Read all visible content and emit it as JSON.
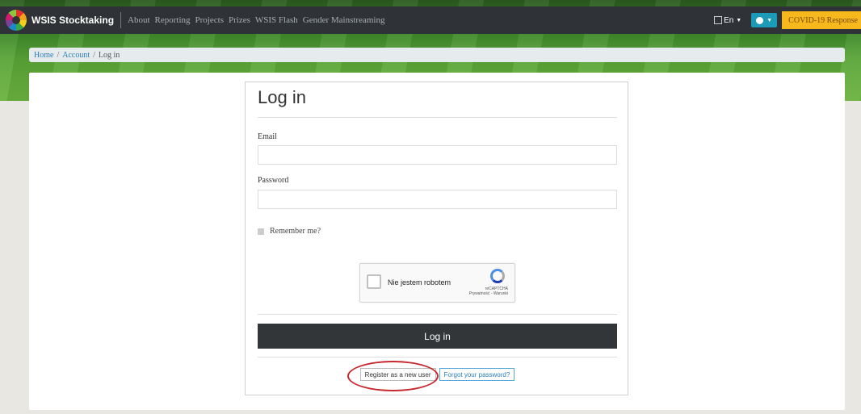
{
  "navbar": {
    "brand": "WSIS Stocktaking",
    "links": [
      "About",
      "Reporting",
      "Projects",
      "Prizes",
      "WSIS Flash",
      "Gender Mainstreaming"
    ],
    "language": "En",
    "covid_button": "COVID-19 Response"
  },
  "breadcrumb": {
    "home": "Home",
    "account": "Account",
    "current": "Log in",
    "separator": "/"
  },
  "login": {
    "title": "Log in",
    "email_label": "Email",
    "email_value": "",
    "password_label": "Password",
    "password_value": "",
    "remember_label": "Remember me?",
    "captcha_text": "Nie jestem robotem",
    "captcha_brand": "reCAPTCHA",
    "captcha_links": "Prywatność - Warunki",
    "submit_label": "Log in",
    "register_label": "Register as a new user",
    "forgot_label": "Forgot your password?"
  },
  "colors": {
    "navbar": "#2f3337",
    "accent_teal": "#1b9bb8",
    "covid": "#f6b81d",
    "annotation": "#c8282f"
  }
}
